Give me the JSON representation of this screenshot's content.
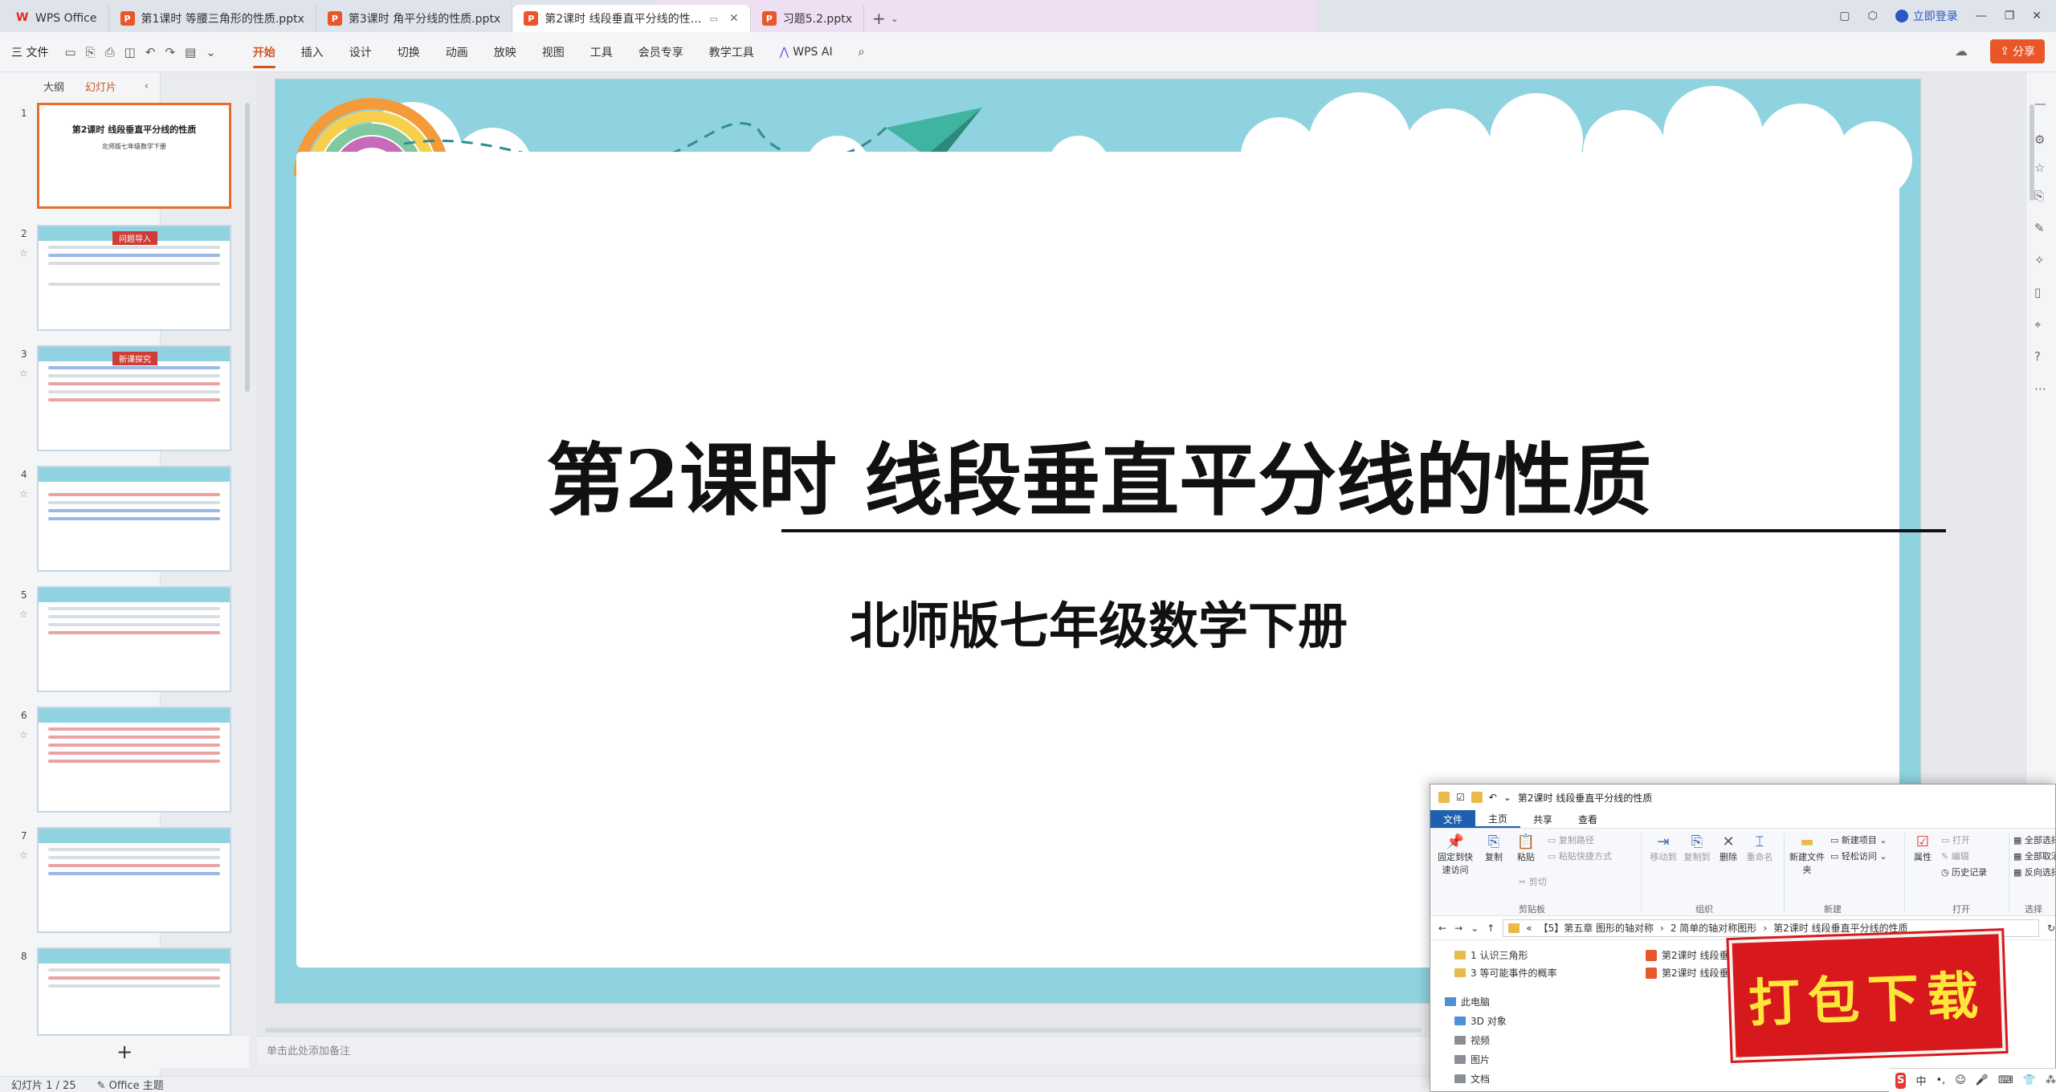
{
  "tabs": [
    {
      "label": "WPS Office",
      "type": "wps"
    },
    {
      "label": "第1课时 等腰三角形的性质.pptx",
      "type": "ppt"
    },
    {
      "label": "第3课时 角平分线的性质.pptx",
      "type": "ppt"
    },
    {
      "label": "第2课时 线段垂直平分线的性…",
      "type": "ppt",
      "active": true
    },
    {
      "label": "习题5.2.pptx",
      "type": "ppt"
    }
  ],
  "window": {
    "login_label": "立即登录"
  },
  "ribbon": {
    "file_menu": "三 文件",
    "tabs": [
      "开始",
      "插入",
      "设计",
      "切换",
      "动画",
      "放映",
      "视图",
      "工具",
      "会员专享",
      "教学工具"
    ],
    "active_tab": "开始",
    "wps_ai": "WPS AI",
    "share": "分享"
  },
  "panel": {
    "tab_outline": "大纲",
    "tab_slides": "幻灯片",
    "thumbs": [
      {
        "num": "1",
        "title": "第2课时 线段垂直平分线的性质",
        "sub": "北师版七年级数学下册"
      },
      {
        "num": "2",
        "badge": "问题导入"
      },
      {
        "num": "3",
        "badge": "新课探究"
      },
      {
        "num": "4"
      },
      {
        "num": "5"
      },
      {
        "num": "6"
      },
      {
        "num": "7"
      },
      {
        "num": "8"
      }
    ]
  },
  "slide": {
    "title": "第2课时 线段垂直平分线的性质",
    "subtitle": "北师版七年级数学下册"
  },
  "notes_placeholder": "单击此处添加备注",
  "status": {
    "slide_counter": "幻灯片 1 / 25",
    "theme": "Office 主题"
  },
  "explorer": {
    "title": "第2课时 线段垂直平分线的性质",
    "tabs": [
      "文件",
      "主页",
      "共享",
      "查看"
    ],
    "buttons": {
      "pin": "固定到快速访问",
      "copy": "复制",
      "paste": "粘贴",
      "copy_path": "复制路径",
      "paste_shortcut": "粘贴快捷方式",
      "cut": "剪切",
      "move_to": "移动到",
      "copy_to": "复制到",
      "delete": "删除",
      "rename": "重命名",
      "new_folder": "新建文件夹",
      "new_item": "新建项目",
      "easy_access": "轻松访问",
      "properties": "属性",
      "open": "打开",
      "edit": "编辑",
      "history": "历史记录",
      "select_all": "全部选择",
      "select_none": "全部取消",
      "invert": "反向选择"
    },
    "groups": [
      "剪贴板",
      "组织",
      "新建",
      "打开",
      "选择"
    ],
    "address": [
      "«",
      "【5】第五章 图形的轴对称",
      "2 简单的轴对称图形",
      "第2课时 线段垂直平分线的性质"
    ],
    "left_items": [
      "1 认识三角形",
      "3 等可能事件的概率",
      "此电脑",
      "3D 对象",
      "视频",
      "图片",
      "文档"
    ],
    "right_items": [
      "第2课时 线段垂直平…",
      "第2课时 线段垂直平…"
    ]
  },
  "stamp": "打包下载",
  "ime": {
    "lang": "中"
  }
}
